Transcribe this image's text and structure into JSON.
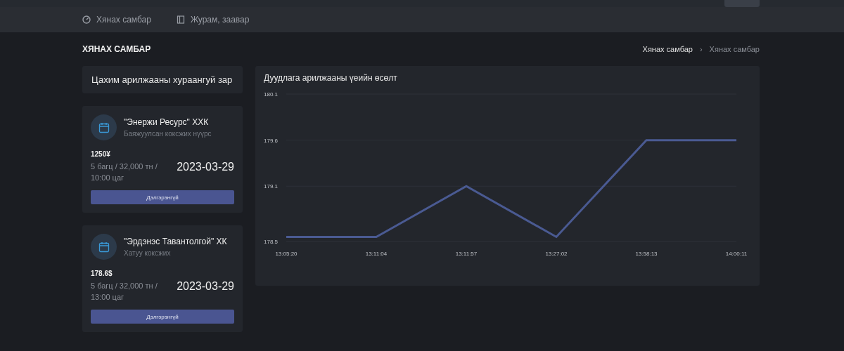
{
  "nav": {
    "items": [
      {
        "label": "Хянах самбар"
      },
      {
        "label": "Журам, заавар"
      }
    ]
  },
  "page": {
    "title": "ХЯНАХ САМБАР",
    "breadcrumb": [
      "Хянах самбар",
      "Хянах самбар"
    ],
    "breadcrumb_separator": "›"
  },
  "summary": {
    "title": "Цахим арилжааны хураангуй зар",
    "cards": [
      {
        "company": "\"Энержи Ресурс\" ХХК",
        "product": "Баяжуулсан коксжих нүүрс",
        "price": "1250¥",
        "details": "5 багц / 32,000 тн / 10:00 цаг",
        "date": "2023-03-29",
        "button": "Дэлгэрэнгүй"
      },
      {
        "company": "\"Эрдэнэс Тавантолгой\" ХК",
        "product": "Хатуу коксжих",
        "price": "178.6$",
        "details": "5 багц / 32,000 тн / 13:00 цаг",
        "date": "2023-03-29",
        "button": "Дэлгэрэнгүй"
      }
    ]
  },
  "chart_panel": {
    "title": "Дуудлага арилжааны үеийн өсөлт",
    "chart_data": {
      "type": "line",
      "categories": [
        "13:05:20",
        "13:11:04",
        "13:11:57",
        "13:27:02",
        "13:58:13",
        "14:00:11"
      ],
      "series": [
        {
          "color": "#4a5a92",
          "values": [
            178.55,
            178.55,
            179.1,
            178.55,
            179.6,
            179.6
          ]
        }
      ],
      "ylim": [
        178.5,
        180.1
      ],
      "yticks": [
        178.5,
        179.1,
        179.6,
        180.1
      ]
    }
  }
}
